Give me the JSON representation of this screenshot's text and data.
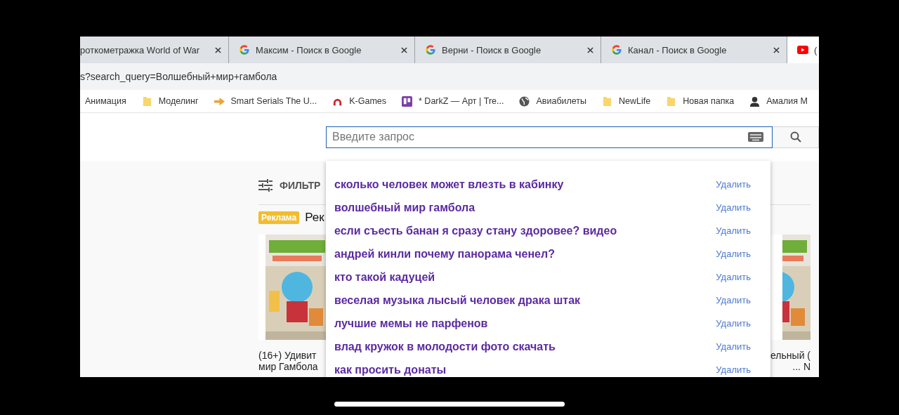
{
  "tabs": [
    {
      "title": "роткометражка World of War",
      "kind": "plain",
      "selected": false
    },
    {
      "title": "Максим - Поиск в Google",
      "kind": "google",
      "selected": false
    },
    {
      "title": "Верни - Поиск в Google",
      "kind": "google",
      "selected": false
    },
    {
      "title": "Канал - Поиск в Google",
      "kind": "google",
      "selected": false
    },
    {
      "title": "(",
      "kind": "video",
      "selected": true
    }
  ],
  "address": "s?search_query=Волшебный+мир+гамбола",
  "bookmarks": [
    {
      "label": "Анимация",
      "kind": "plain"
    },
    {
      "label": "Моделинг",
      "kind": "folder"
    },
    {
      "label": "Smart Serials The U...",
      "kind": "arrow"
    },
    {
      "label": "K-Games",
      "kind": "arc"
    },
    {
      "label": "* DarkZ — Арт | Tre...",
      "kind": "board"
    },
    {
      "label": "Авиабилеты",
      "kind": "globe"
    },
    {
      "label": "NewLife",
      "kind": "folder"
    },
    {
      "label": "Новая папка",
      "kind": "folder"
    },
    {
      "label": "Амалия М",
      "kind": "person"
    }
  ],
  "search": {
    "placeholder": "Введите запрос"
  },
  "filter": "ФИЛЬТР",
  "ad": {
    "badge": "Реклама",
    "title": "Рек"
  },
  "products": [
    {
      "kind": "picture",
      "caption": [
        "(16+) Удивит",
        "мир Гамбола"
      ]
    },
    {
      "kind": "picture",
      "caption": [
        "ельный (",
        "...  N"
      ]
    }
  ],
  "suggestions": [
    {
      "text": "сколько человек может влезть в кабинку",
      "action": "Удалить"
    },
    {
      "text": "волшебный мир гамбола",
      "action": "Удалить"
    },
    {
      "text": "если съесть банан я сразу стану здоровее? видео",
      "action": "Удалить"
    },
    {
      "text": "андрей кинли почему панорама ченел?",
      "action": "Удалить"
    },
    {
      "text": "кто такой кадуцей",
      "action": "Удалить"
    },
    {
      "text": "веселая музыка лысый человек драка штак",
      "action": "Удалить"
    },
    {
      "text": "лучшие мемы не парфенов",
      "action": "Удалить"
    },
    {
      "text": "влад кружок в молодости фото скачать",
      "action": "Удалить"
    },
    {
      "text": "как просить донаты",
      "action": "Удалить"
    }
  ]
}
